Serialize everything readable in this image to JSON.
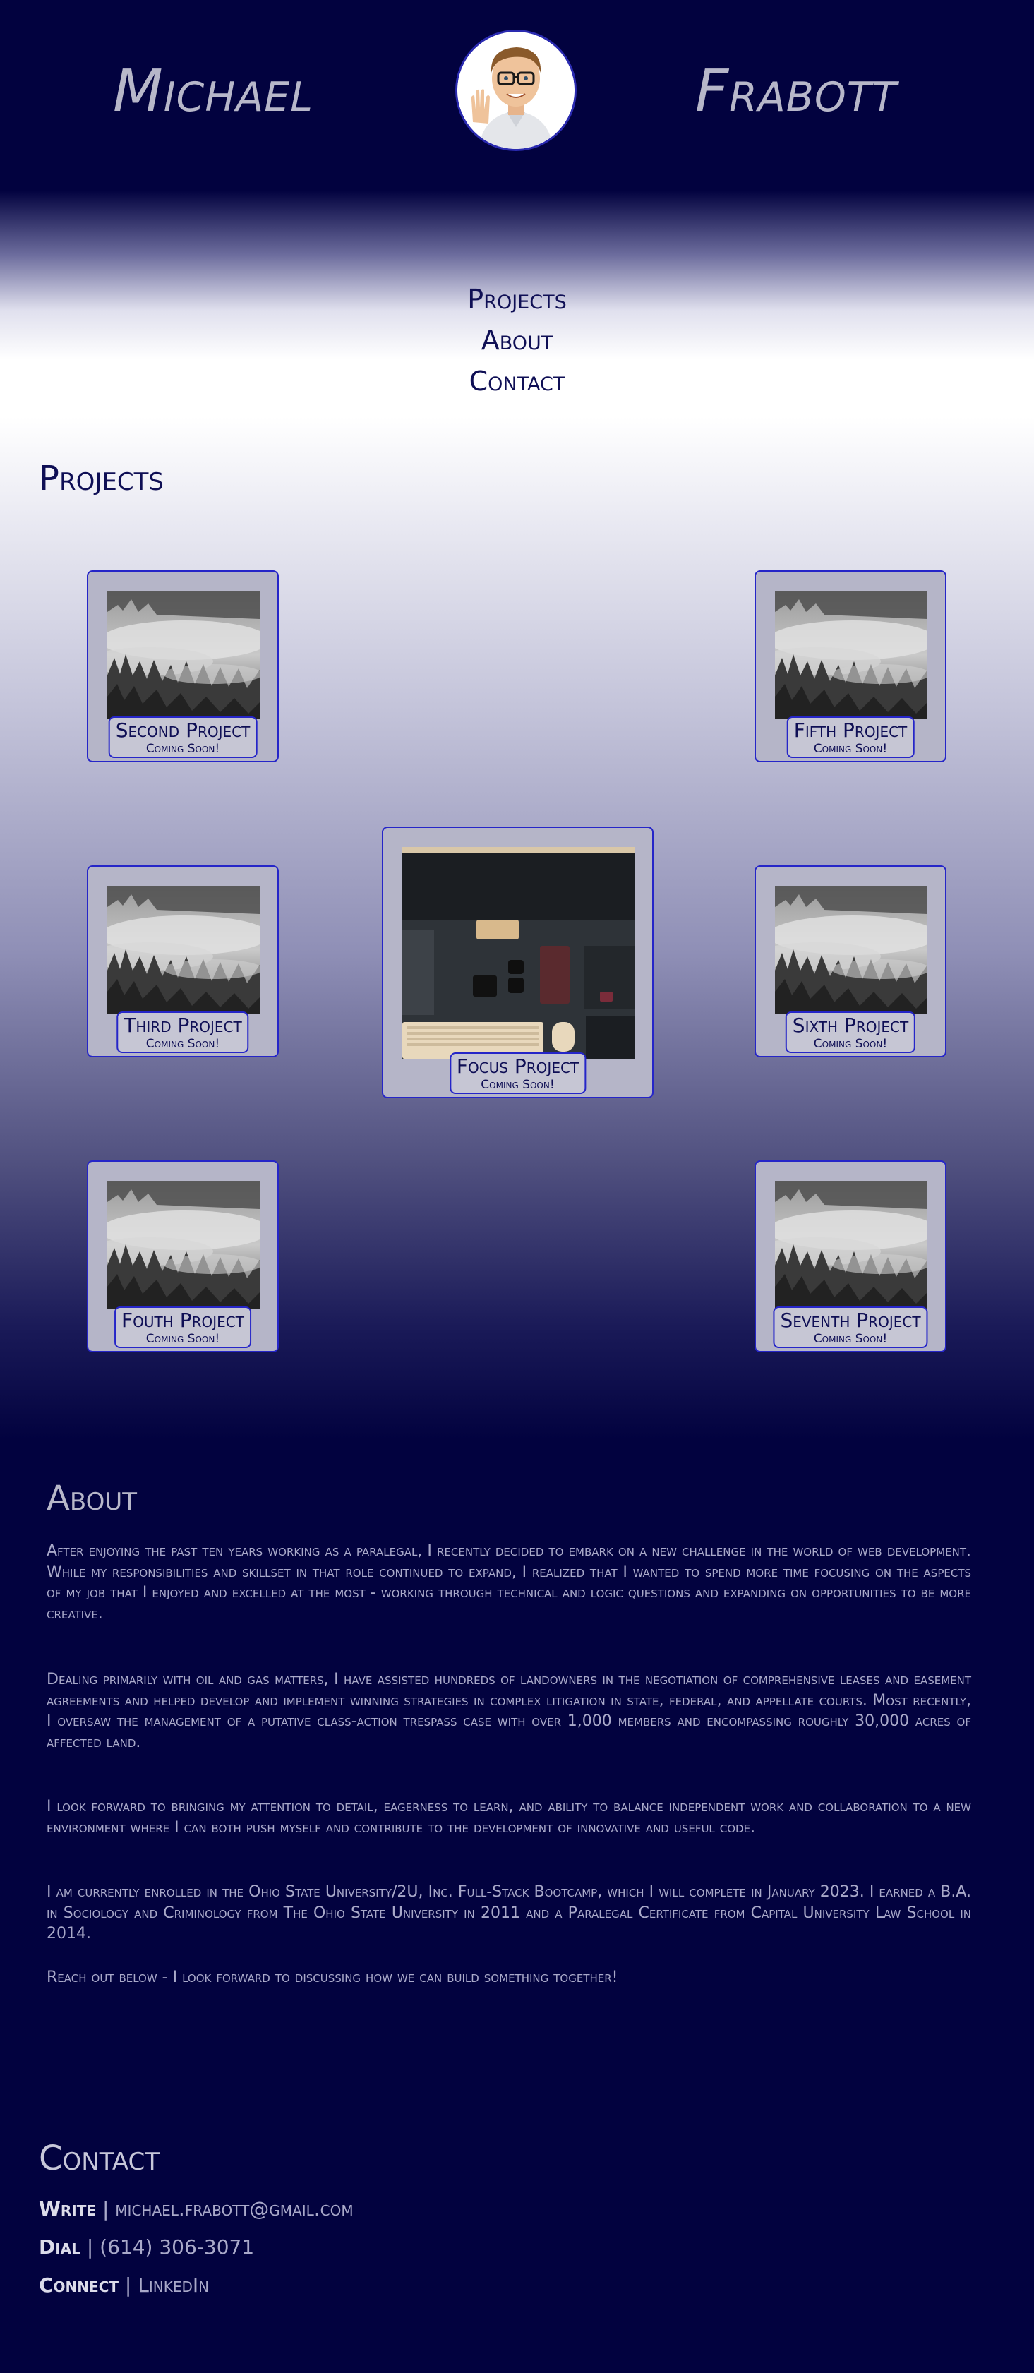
{
  "header": {
    "first_name": "Michael",
    "last_name": "Frabott"
  },
  "nav": {
    "projects": "Projects",
    "about": "About",
    "contact": "Contact"
  },
  "projects": {
    "title": "Projects",
    "cards": [
      {
        "title": "Second Project",
        "status": "Coming Soon!"
      },
      {
        "title": "Fifth Project",
        "status": "Coming Soon!"
      },
      {
        "title": "Third Project",
        "status": "Coming Soon!"
      },
      {
        "title": "Focus Project",
        "status": "Coming Soon!"
      },
      {
        "title": "Sixth Project",
        "status": "Coming Soon!"
      },
      {
        "title": "Fouth Project",
        "status": "Coming Soon!"
      },
      {
        "title": "Seventh Project",
        "status": "Coming Soon!"
      }
    ]
  },
  "about": {
    "title": "About",
    "paragraphs": [
      "After enjoying the past ten years working as a paralegal, I recently decided to embark on a new challenge in the world of web development. While my responsibilities and skillset in that role continued to expand, I realized that I wanted to spend more time focusing on the aspects of my job that I enjoyed and excelled at the most - working through technical and logic questions and expanding on opportunities to be more creative.",
      "Dealing primarily with oil and gas matters, I have assisted hundreds of landowners in the negotiation of comprehensive leases and easement agreements and helped develop and implement winning strategies in complex litigation in state, federal, and appellate courts. Most recently, I oversaw the management of a putative class-action trespass case with over 1,000 members and encompassing roughly 30,000 acres of affected land.",
      "I look forward to bringing my attention to detail, eagerness to learn, and ability to balance independent work and collaboration to a new environment where I can both push myself and contribute to the development of innovative and useful code.",
      "I am currently enrolled in the Ohio State University/2U, Inc. Full-Stack Bootcamp, which I will complete in January 2023. I earned a B.A. in Sociology and Criminology from The Ohio State University in 2011 and a Paralegal Certificate from Capital University Law School in 2014.",
      "Reach out below - I look forward to discussing how we can build something together!"
    ]
  },
  "contact": {
    "title": "Contact",
    "write_label": "Write",
    "write_value": "michael.frabott@gmail.com",
    "dial_label": "Dial",
    "dial_value": "(614) 306-3071",
    "connect_label": "Connect",
    "connect_value": "LinkedIn",
    "separator": "|"
  }
}
